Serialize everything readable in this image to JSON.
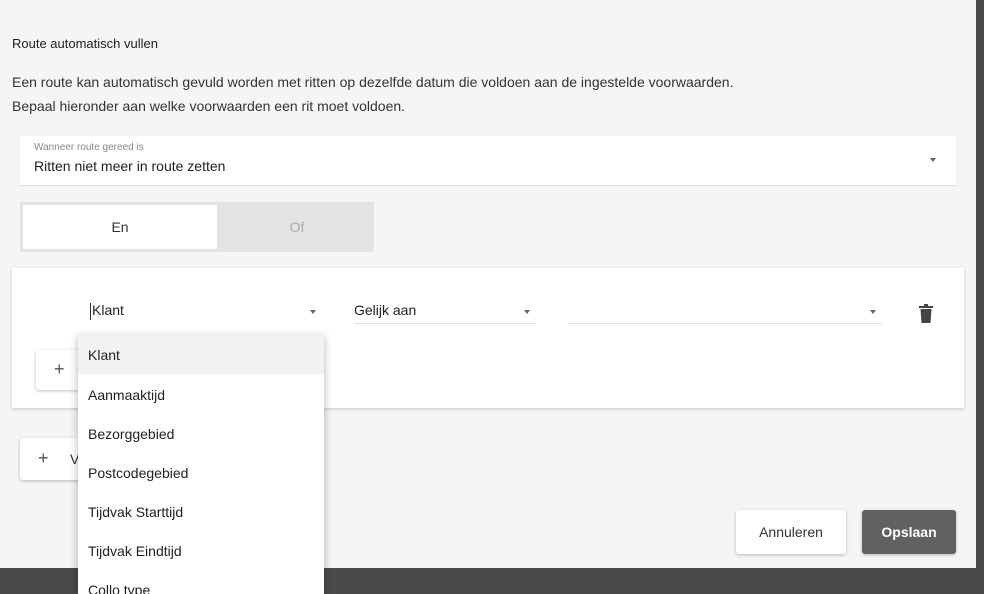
{
  "dialog": {
    "section_title": "Route automatisch vullen",
    "description_line1": "Een route kan automatisch gevuld worden met ritten op dezelfde datum die voldoen aan de ingestelde voorwaarden.",
    "description_line2": "Bepaal hieronder aan welke voorwaarden een rit moet voldoen.",
    "completion_select": {
      "label": "Wanneer route gereed is",
      "value": "Ritten niet meer in route zetten"
    },
    "logic_toggle": {
      "options": [
        "En",
        "Of"
      ],
      "selected": "En"
    },
    "condition": {
      "field_value": "Klant",
      "operator_value": "Gelijk aan",
      "comparison_value": ""
    },
    "add_group_label": "V",
    "buttons": {
      "cancel": "Annuleren",
      "save": "Opslaan"
    }
  },
  "field_dropdown": {
    "options": [
      "Klant",
      "Aanmaaktijd",
      "Bezorggebied",
      "Postcodegebied",
      "Tijdvak Starttijd",
      "Tijdvak Eindtijd",
      "Collo type"
    ]
  },
  "icons": {
    "delete": "trash-icon",
    "add": "plus-icon",
    "dropdown": "caret-down-icon"
  },
  "colors": {
    "save_button": "#616161",
    "dialog_background": "#f5f5f5",
    "overlay": "#4a4a4a"
  }
}
